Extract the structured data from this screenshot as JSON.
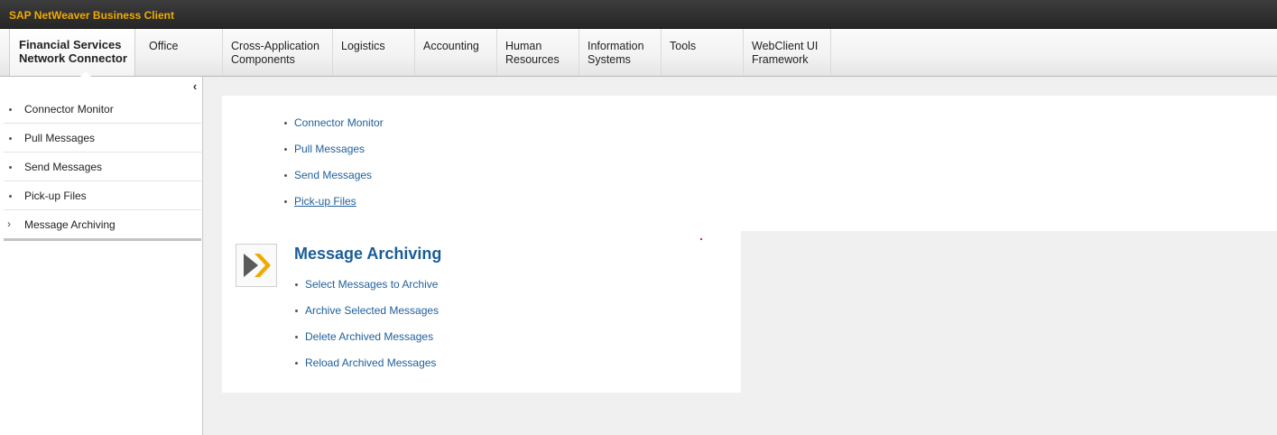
{
  "app": {
    "title": "SAP NetWeaver Business Client"
  },
  "nav": {
    "tabs": [
      {
        "line1": "Financial Services",
        "line2": "Network Connector",
        "active": true
      },
      {
        "line1": "Office",
        "line2": ""
      },
      {
        "line1": "Cross-Application",
        "line2": "Components"
      },
      {
        "line1": "Logistics",
        "line2": ""
      },
      {
        "line1": "Accounting",
        "line2": ""
      },
      {
        "line1": "Human",
        "line2": "Resources"
      },
      {
        "line1": "Information",
        "line2": "Systems"
      },
      {
        "line1": "Tools",
        "line2": ""
      },
      {
        "line1": "WebClient UI",
        "line2": "Framework"
      }
    ]
  },
  "sidebar": {
    "collapse_icon": "chevron-left-icon",
    "items": [
      {
        "label": "Connector Monitor"
      },
      {
        "label": "Pull Messages"
      },
      {
        "label": "Send Messages"
      },
      {
        "label": "Pick-up Files"
      },
      {
        "label": "Message Archiving"
      }
    ]
  },
  "content": {
    "links": [
      {
        "label": "Connector Monitor"
      },
      {
        "label": "Pull Messages"
      },
      {
        "label": "Send Messages"
      },
      {
        "label": "Pick-up Files"
      }
    ],
    "section": {
      "title": "Message Archiving",
      "icon": "play-forward-icon",
      "links": [
        {
          "label": "Select Messages to Archive"
        },
        {
          "label": "Archive Selected Messages"
        },
        {
          "label": "Delete Archived Messages"
        },
        {
          "label": "Reload Archived Messages"
        }
      ]
    }
  },
  "colors": {
    "title_accent": "#f0ab00",
    "link": "#1f5f9a",
    "section_title": "#1a5d96",
    "icon_arrow_dark": "#5a5a5a",
    "icon_arrow_accent": "#f0ab00"
  }
}
